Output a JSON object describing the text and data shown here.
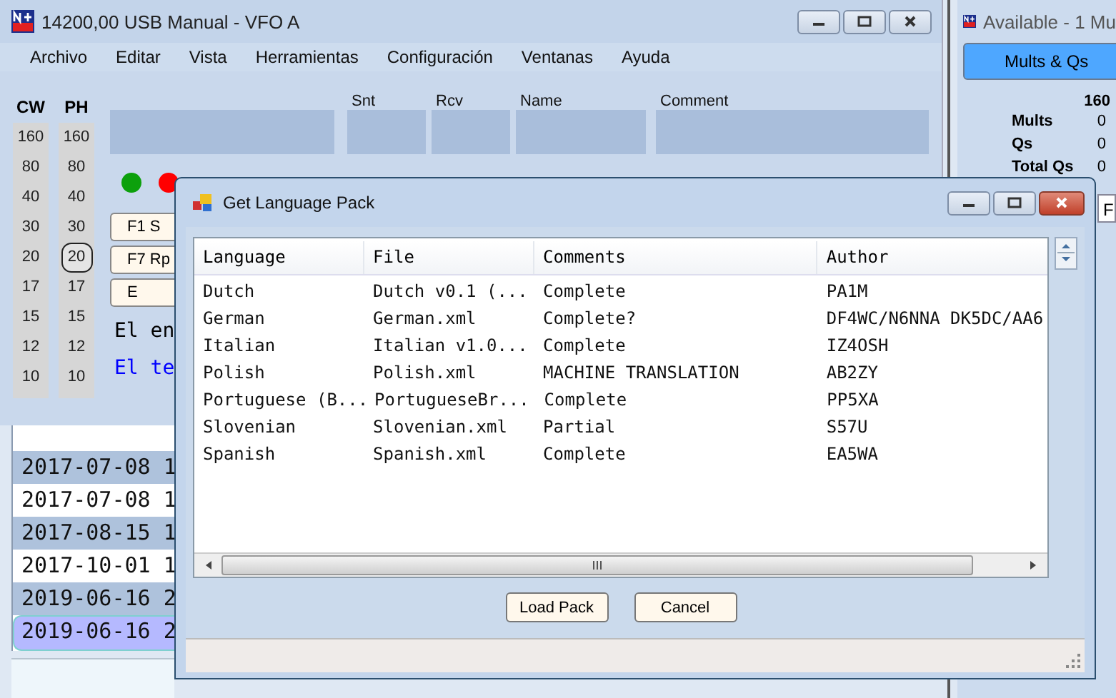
{
  "main_window": {
    "title": "14200,00 USB Manual - VFO A",
    "menu": [
      "Archivo",
      "Editar",
      "Vista",
      "Herramientas",
      "Configuración",
      "Ventanas",
      "Ayuda"
    ],
    "band_columns": [
      {
        "header": "CW",
        "bands": [
          {
            "label": "160",
            "selected": false
          },
          {
            "label": "80",
            "selected": false
          },
          {
            "label": "40",
            "selected": false
          },
          {
            "label": "30",
            "selected": false
          },
          {
            "label": "20",
            "selected": false
          },
          {
            "label": "17",
            "selected": false
          },
          {
            "label": "15",
            "selected": false
          },
          {
            "label": "12",
            "selected": false
          },
          {
            "label": "10",
            "selected": false
          }
        ]
      },
      {
        "header": "PH",
        "bands": [
          {
            "label": "160",
            "selected": false
          },
          {
            "label": "80",
            "selected": false
          },
          {
            "label": "40",
            "selected": false
          },
          {
            "label": "30",
            "selected": false
          },
          {
            "label": "20",
            "selected": true
          },
          {
            "label": "17",
            "selected": false
          },
          {
            "label": "15",
            "selected": false
          },
          {
            "label": "12",
            "selected": false
          },
          {
            "label": "10",
            "selected": false
          }
        ]
      }
    ],
    "entry_fields": [
      {
        "label": "Snt"
      },
      {
        "label": "Rcv"
      },
      {
        "label": "Name"
      },
      {
        "label": "Comment"
      }
    ],
    "indicators": [
      {
        "color": "#0ca00c"
      },
      {
        "color": "#ff0000"
      }
    ],
    "function_keys": [
      "F1 S",
      "F7 Rp",
      "E"
    ],
    "messages": [
      {
        "text": "El en",
        "color": "#000000"
      },
      {
        "text": "El te",
        "color": "#0000ff"
      }
    ]
  },
  "log": {
    "rows": [
      {
        "text": "2017-07-08 1",
        "selected": false
      },
      {
        "text": "2017-07-08 1",
        "selected": false
      },
      {
        "text": "2017-08-15 1",
        "selected": false
      },
      {
        "text": "2017-10-01 1",
        "selected": false
      },
      {
        "text": "2019-06-16 2",
        "selected": false
      },
      {
        "text": "2019-06-16 2",
        "selected": true
      }
    ]
  },
  "side_window": {
    "title": "Available - 1 Mu",
    "button": "Mults & Qs",
    "band_header": "160",
    "stats": [
      {
        "label": "Mults",
        "value": "0"
      },
      {
        "label": "Qs",
        "value": "0"
      },
      {
        "label": "Total Qs",
        "value": "0"
      }
    ],
    "tab_fragment": "F"
  },
  "dialog": {
    "title": "Get Language Pack",
    "columns": [
      "Language",
      "File",
      "Comments",
      "Author"
    ],
    "rows": [
      [
        "Dutch",
        "Dutch v0.1 (...",
        "Complete",
        "PA1M"
      ],
      [
        "German",
        "German.xml",
        "Complete?",
        "DF4WC/N6NNA DK5DC/AA6"
      ],
      [
        "Italian",
        "Italian v1.0...",
        "Complete",
        "IZ4OSH"
      ],
      [
        "Polish",
        "Polish.xml",
        "MACHINE TRANSLATION",
        "AB2ZY"
      ],
      [
        "Portuguese (B...",
        "PortugueseBr...",
        "Complete",
        "PP5XA"
      ],
      [
        "Slovenian",
        "Slovenian.xml",
        "Partial",
        "S57U"
      ],
      [
        "Spanish",
        "Spanish.xml",
        "Complete",
        "EA5WA"
      ]
    ],
    "buttons": [
      "Load Pack",
      "Cancel"
    ]
  }
}
